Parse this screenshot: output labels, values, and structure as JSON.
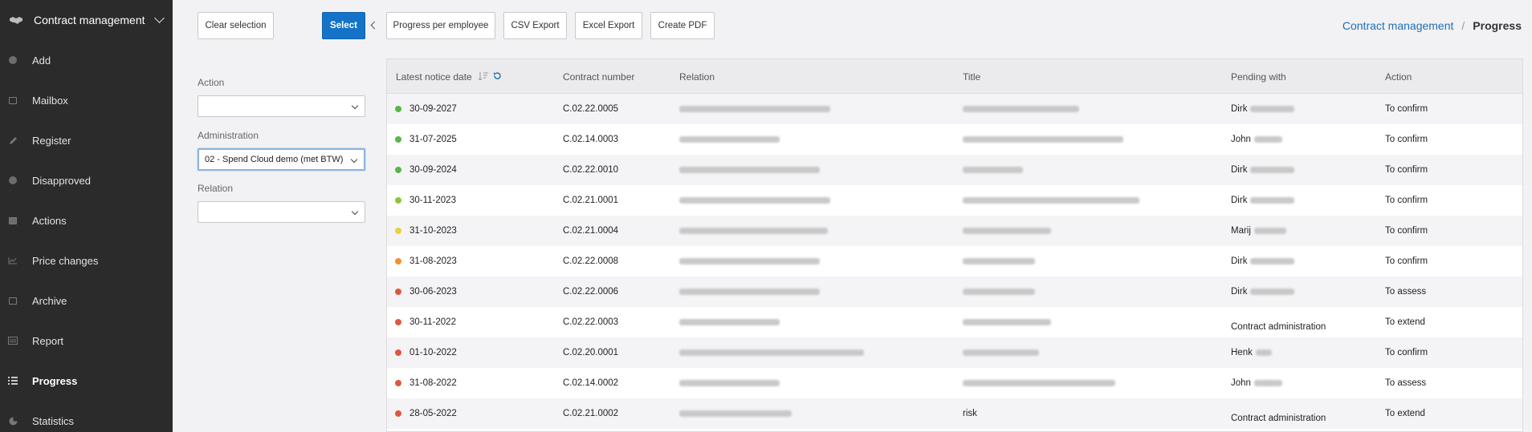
{
  "sidebar": {
    "title": "Contract management",
    "title_icon": "handshake-icon",
    "items": [
      {
        "label": "Add",
        "icon": "plus-circle-icon"
      },
      {
        "label": "Mailbox",
        "icon": "inbox-icon"
      },
      {
        "label": "Register",
        "icon": "pencil-icon"
      },
      {
        "label": "Disapproved",
        "icon": "ban-circle-icon"
      },
      {
        "label": "Actions",
        "icon": "checkbox-icon"
      },
      {
        "label": "Price changes",
        "icon": "line-chart-icon"
      },
      {
        "label": "Archive",
        "icon": "archive-box-icon"
      },
      {
        "label": "Report",
        "icon": "report-icon"
      },
      {
        "label": "Progress",
        "icon": "list-icon"
      },
      {
        "label": "Statistics",
        "icon": "pie-chart-icon"
      }
    ],
    "active": "Progress"
  },
  "toolbar": {
    "clear_selection": "Clear selection",
    "select": "Select",
    "progress_per_employee": "Progress per employee",
    "csv_export": "CSV Export",
    "excel_export": "Excel Export",
    "create_pdf": "Create PDF"
  },
  "breadcrumb": {
    "parent": "Contract management",
    "separator": "/",
    "current": "Progress"
  },
  "filters": {
    "action_label": "Action",
    "action_value": "",
    "administration_label": "Administration",
    "administration_value": "02 - Spend Cloud demo (met BTW)",
    "relation_label": "Relation",
    "relation_value": ""
  },
  "table": {
    "columns": {
      "date": "Latest notice date",
      "contract": "Contract number",
      "relation": "Relation",
      "title": "Title",
      "pending": "Pending with",
      "action": "Action"
    },
    "rows": [
      {
        "status_color": "#56b846",
        "date": "30-09-2027",
        "contract": "C.02.22.0005",
        "title": "",
        "pending_name": "Dirk",
        "pending_other": "",
        "action": "To confirm"
      },
      {
        "status_color": "#56b846",
        "date": "31-07-2025",
        "contract": "C.02.14.0003",
        "title": "",
        "pending_name": "John",
        "pending_other": "",
        "action": "To confirm"
      },
      {
        "status_color": "#56b846",
        "date": "30-09-2024",
        "contract": "C.02.22.0010",
        "title": "",
        "pending_name": "Dirk",
        "pending_other": "",
        "action": "To confirm"
      },
      {
        "status_color": "#8cc63f",
        "date": "30-11-2023",
        "contract": "C.02.21.0001",
        "title": "",
        "pending_name": "Dirk",
        "pending_other": "",
        "action": "To confirm"
      },
      {
        "status_color": "#e8d23a",
        "date": "31-10-2023",
        "contract": "C.02.21.0004",
        "title": "",
        "pending_name": "Marij",
        "pending_other": "",
        "action": "To confirm"
      },
      {
        "status_color": "#f0922b",
        "date": "31-08-2023",
        "contract": "C.02.22.0008",
        "title": "",
        "pending_name": "Dirk",
        "pending_other": "",
        "action": "To confirm"
      },
      {
        "status_color": "#e0573e",
        "date": "30-06-2023",
        "contract": "C.02.22.0006",
        "title": "",
        "pending_name": "Dirk",
        "pending_other": "",
        "action": "To assess"
      },
      {
        "status_color": "#e0573e",
        "date": "30-11-2022",
        "contract": "C.02.22.0003",
        "title": "",
        "pending_name": "",
        "pending_other": "Contract administration",
        "action": "To extend"
      },
      {
        "status_color": "#e0573e",
        "date": "01-10-2022",
        "contract": "C.02.20.0001",
        "title": "",
        "pending_name": "Henk",
        "pending_other": "",
        "action": "To confirm"
      },
      {
        "status_color": "#e0573e",
        "date": "31-08-2022",
        "contract": "C.02.14.0002",
        "title": "",
        "pending_name": "John",
        "pending_other": "",
        "action": "To assess"
      },
      {
        "status_color": "#e0573e",
        "date": "28-05-2022",
        "contract": "C.02.21.0002",
        "title": "risk",
        "pending_name": "",
        "pending_other": "Contract administration",
        "action": "To extend"
      }
    ]
  }
}
